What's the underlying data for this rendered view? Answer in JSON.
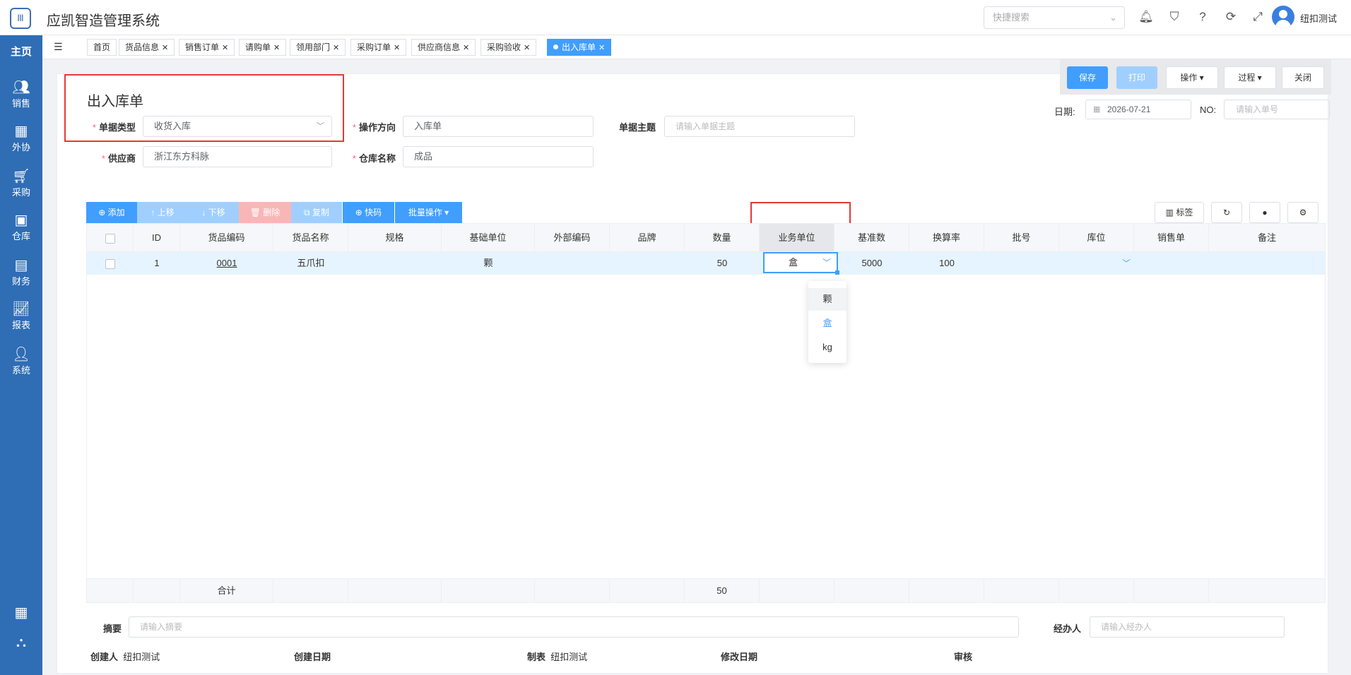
{
  "app": {
    "title": "应凯智造管理系统",
    "logo_text": "|||"
  },
  "header": {
    "search_placeholder": "快捷搜索",
    "username": "纽扣测试"
  },
  "sidebar": {
    "home": "主页",
    "items": [
      {
        "label": "销售",
        "icon": "users-icon"
      },
      {
        "label": "外协",
        "icon": "building-icon"
      },
      {
        "label": "采购",
        "icon": "cart-icon"
      },
      {
        "label": "仓库",
        "icon": "warehouse-icon"
      },
      {
        "label": "财务",
        "icon": "finance-icon"
      },
      {
        "label": "报表",
        "icon": "chart-icon"
      },
      {
        "label": "系统",
        "icon": "user-icon"
      }
    ]
  },
  "tabs": [
    {
      "label": "首页",
      "closable": false
    },
    {
      "label": "货品信息",
      "closable": true
    },
    {
      "label": "销售订单",
      "closable": true
    },
    {
      "label": "请购单",
      "closable": true
    },
    {
      "label": "领用部门",
      "closable": true
    },
    {
      "label": "采购订单",
      "closable": true
    },
    {
      "label": "供应商信息",
      "closable": true
    },
    {
      "label": "采购验收",
      "closable": true
    },
    {
      "label": "出入库单",
      "closable": true,
      "active": true
    }
  ],
  "actions": {
    "save": "保存",
    "print": "打印",
    "operate": "操作",
    "process": "过程",
    "close": "关闭"
  },
  "form": {
    "title": "出入库单",
    "doc_type_label": "单据类型",
    "doc_type_value": "收货入库",
    "direction_label": "操作方向",
    "direction_value": "入库单",
    "subject_label": "单据主题",
    "subject_placeholder": "请输入单据主题",
    "supplier_label": "供应商",
    "supplier_value": "浙江东方科脉",
    "warehouse_label": "仓库名称",
    "warehouse_value": "成品",
    "date_label": "日期:",
    "date_value": "2026-07-21",
    "no_label": "NO:",
    "no_placeholder": "请输入单号"
  },
  "toolbar": {
    "add": "⊕ 添加",
    "up": "↑ 上移",
    "down": "↓ 下移",
    "delete": "🗑 删除",
    "copy": "⧉ 复制",
    "quick": "⊕ 快码",
    "batch": "批量操作 ▾",
    "tag": "标签"
  },
  "grid": {
    "columns": [
      "",
      "ID",
      "货品编码",
      "货品名称",
      "规格",
      "基础单位",
      "外部编码",
      "品牌",
      "数量",
      "业务单位",
      "基准数",
      "换算率",
      "批号",
      "库位",
      "销售单",
      "备注"
    ],
    "row": {
      "id": "1",
      "code": "0001",
      "name": "五爪扣",
      "spec": "",
      "base_unit": "颗",
      "ext_code": "",
      "brand": "",
      "qty": "50",
      "biz_unit": "盒",
      "base_qty": "5000",
      "rate": "100",
      "batch": "",
      "location": "",
      "sales_order": "",
      "remark": ""
    },
    "unit_options": [
      "颗",
      "盒",
      "kg"
    ],
    "footer": {
      "label": "合计",
      "qty_total": "50"
    }
  },
  "bottom": {
    "memo_label": "摘要",
    "memo_placeholder": "请输入摘要",
    "handler_label": "经办人",
    "handler_placeholder": "请输入经办人",
    "creator_label": "创建人",
    "creator_value": "纽扣测试",
    "created_label": "创建日期",
    "maker_label": "制表",
    "maker_value": "纽扣测试",
    "modified_label": "修改日期",
    "audit_label": "审核"
  },
  "colors": {
    "sidebar": "#2f6db5",
    "primary": "#409eff",
    "highlight": "#e53935"
  }
}
